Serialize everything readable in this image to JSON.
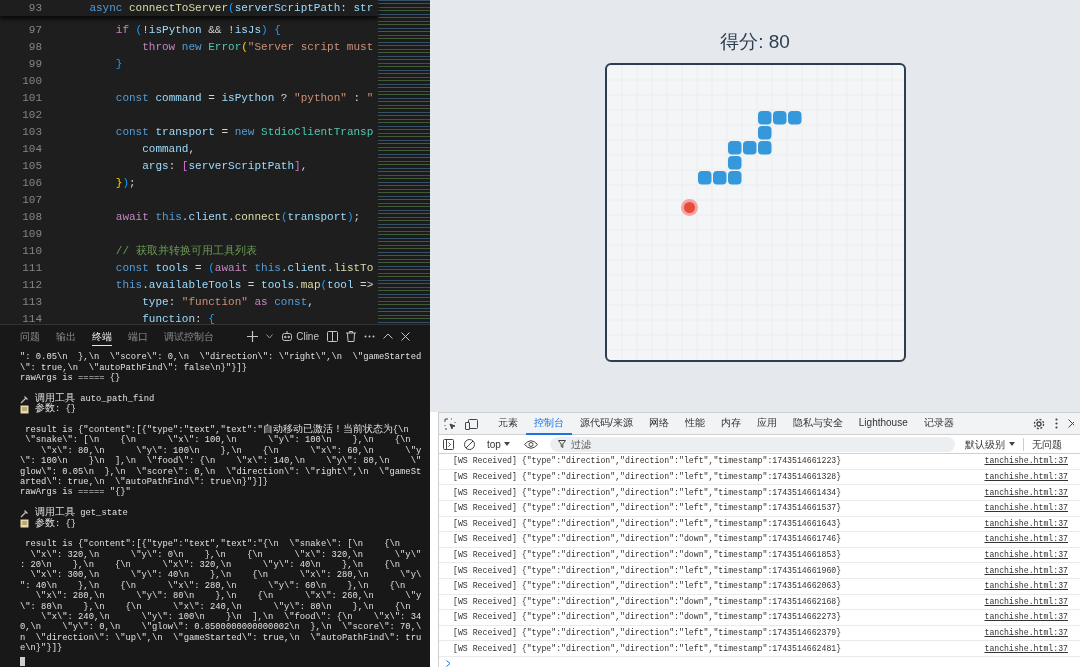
{
  "editor": {
    "sticky_line": {
      "number": "93",
      "tokens": [
        {
          "kind": "kw",
          "text": "    async"
        },
        {
          "kind": "fn",
          "text": " connectToServer"
        },
        {
          "kind": "br",
          "text": "("
        },
        {
          "kind": "var",
          "text": "serverScriptPath"
        },
        {
          "kind": "p",
          "text": ": "
        },
        {
          "kind": "var",
          "text": "str"
        }
      ]
    },
    "lines": [
      {
        "number": "97",
        "tokens": [
          {
            "kind": "ctl",
            "text": "        if"
          },
          {
            "kind": "br",
            "text": " ("
          },
          {
            "kind": "p",
            "text": "!"
          },
          {
            "kind": "var",
            "text": "isPython"
          },
          {
            "kind": "p",
            "text": " && !"
          },
          {
            "kind": "var",
            "text": "isJs"
          },
          {
            "kind": "br",
            "text": ") {"
          }
        ]
      },
      {
        "number": "98",
        "tokens": [
          {
            "kind": "ctl",
            "text": "            throw"
          },
          {
            "kind": "kw",
            "text": " new"
          },
          {
            "kind": "type",
            "text": " Error"
          },
          {
            "kind": "gold",
            "text": "("
          },
          {
            "kind": "str",
            "text": "\"Server script must"
          }
        ]
      },
      {
        "number": "99",
        "tokens": [
          {
            "kind": "br",
            "text": "        }"
          }
        ]
      },
      {
        "number": "100"
      },
      {
        "number": "101",
        "tokens": [
          {
            "kind": "kw",
            "text": "        const"
          },
          {
            "kind": "var",
            "text": " command"
          },
          {
            "kind": "p",
            "text": " = "
          },
          {
            "kind": "var",
            "text": "isPython"
          },
          {
            "kind": "p",
            "text": " ? "
          },
          {
            "kind": "str",
            "text": "\"python\""
          },
          {
            "kind": "p",
            "text": " : "
          },
          {
            "kind": "str",
            "text": "\""
          }
        ]
      },
      {
        "number": "102"
      },
      {
        "number": "103",
        "tokens": [
          {
            "kind": "kw",
            "text": "        const"
          },
          {
            "kind": "var",
            "text": " transport"
          },
          {
            "kind": "p",
            "text": " = "
          },
          {
            "kind": "kw",
            "text": "new"
          },
          {
            "kind": "type",
            "text": " StdioClientTransp"
          }
        ]
      },
      {
        "number": "104",
        "tokens": [
          {
            "kind": "var",
            "text": "            command"
          },
          {
            "kind": "p",
            "text": ","
          }
        ]
      },
      {
        "number": "105",
        "tokens": [
          {
            "kind": "var",
            "text": "            args"
          },
          {
            "kind": "p",
            "text": ": "
          },
          {
            "kind": "pink",
            "text": "["
          },
          {
            "kind": "var",
            "text": "serverScriptPath"
          },
          {
            "kind": "pink",
            "text": "]"
          },
          {
            "kind": "p",
            "text": ","
          }
        ]
      },
      {
        "number": "106",
        "tokens": [
          {
            "kind": "gold",
            "text": "        }"
          },
          {
            "kind": "br",
            "text": ")"
          },
          {
            "kind": "p",
            "text": ";"
          }
        ]
      },
      {
        "number": "107"
      },
      {
        "number": "108",
        "tokens": [
          {
            "kind": "ctl",
            "text": "        await"
          },
          {
            "kind": "kw",
            "text": " this"
          },
          {
            "kind": "p",
            "text": "."
          },
          {
            "kind": "var",
            "text": "client"
          },
          {
            "kind": "p",
            "text": "."
          },
          {
            "kind": "fn",
            "text": "connect"
          },
          {
            "kind": "br",
            "text": "("
          },
          {
            "kind": "var",
            "text": "transport"
          },
          {
            "kind": "br",
            "text": ")"
          },
          {
            "kind": "p",
            "text": ";"
          }
        ]
      },
      {
        "number": "109"
      },
      {
        "number": "110",
        "tokens": [
          {
            "kind": "com",
            "text": "        // 获取并转换可用工具列表"
          }
        ]
      },
      {
        "number": "111",
        "tokens": [
          {
            "kind": "kw",
            "text": "        const"
          },
          {
            "kind": "var",
            "text": " tools"
          },
          {
            "kind": "p",
            "text": " = "
          },
          {
            "kind": "br",
            "text": "("
          },
          {
            "kind": "ctl",
            "text": "await"
          },
          {
            "kind": "kw",
            "text": " this"
          },
          {
            "kind": "p",
            "text": "."
          },
          {
            "kind": "var",
            "text": "client"
          },
          {
            "kind": "p",
            "text": "."
          },
          {
            "kind": "fn",
            "text": "listTo"
          }
        ]
      },
      {
        "number": "112",
        "tokens": [
          {
            "kind": "kw",
            "text": "        this"
          },
          {
            "kind": "p",
            "text": "."
          },
          {
            "kind": "var",
            "text": "availableTools"
          },
          {
            "kind": "p",
            "text": " = "
          },
          {
            "kind": "var",
            "text": "tools"
          },
          {
            "kind": "p",
            "text": "."
          },
          {
            "kind": "fn",
            "text": "map"
          },
          {
            "kind": "br",
            "text": "("
          },
          {
            "kind": "var",
            "text": "tool"
          },
          {
            "kind": "p",
            "text": " =>"
          }
        ]
      },
      {
        "number": "113",
        "tokens": [
          {
            "kind": "var",
            "text": "            type"
          },
          {
            "kind": "p",
            "text": ": "
          },
          {
            "kind": "str",
            "text": "\"function\""
          },
          {
            "kind": "ctl",
            "text": " as"
          },
          {
            "kind": "kw",
            "text": " const"
          },
          {
            "kind": "p",
            "text": ","
          }
        ]
      },
      {
        "number": "114",
        "tokens": [
          {
            "kind": "var",
            "text": "            function"
          },
          {
            "kind": "p",
            "text": ": "
          },
          {
            "kind": "br",
            "text": "{"
          }
        ]
      }
    ]
  },
  "terminal": {
    "tabs": [
      {
        "label": "问题",
        "selected": false
      },
      {
        "label": "输出",
        "selected": false
      },
      {
        "label": "终端",
        "selected": true
      },
      {
        "label": "端口",
        "selected": false
      },
      {
        "label": "调试控制台",
        "selected": false
      }
    ],
    "cline_label": "Cline",
    "lines": [
      {
        "kind": "output",
        "text": "\": 0.05\\n  },\\n  \\\"score\\\": 0,\\n  \\\"direction\\\": \\\"right\\\",\\n  \\\"gameStarted"
      },
      {
        "kind": "output",
        "text": "\\\": true,\\n  \\\"autoPathFind\\\": false\\n}\"}]}"
      },
      {
        "kind": "output",
        "text": "rawArgs is ===== {}"
      },
      {
        "kind": "blank"
      },
      {
        "kind": "tool",
        "text": "调用工具 auto_path_find"
      },
      {
        "kind": "args",
        "text": "参数: {}"
      },
      {
        "kind": "blank"
      },
      {
        "kind": "output",
        "text": " result is {\"content\":[{\"type\":\"text\",\"text\":\"自动移动已激活！当前状态为{\\n"
      },
      {
        "kind": "output",
        "text": " \\\"snake\\\": [\\n    {\\n      \\\"x\\\": 100,\\n      \\\"y\\\": 100\\n    },\\n    {\\n"
      },
      {
        "kind": "output",
        "text": "    \\\"x\\\": 80,\\n      \\\"y\\\": 100\\n    },\\n    {\\n      \\\"x\\\": 60,\\n      \\\"y"
      },
      {
        "kind": "output",
        "text": "\\\": 100\\n    }\\n  ],\\n  \\\"food\\\": {\\n    \\\"x\\\": 140,\\n    \\\"y\\\": 80,\\n    \\\""
      },
      {
        "kind": "output",
        "text": "glow\\\": 0.05\\n  },\\n  \\\"score\\\": 0,\\n  \\\"direction\\\": \\\"right\\\",\\n  \\\"gameSt"
      },
      {
        "kind": "output",
        "text": "arted\\\": true,\\n  \\\"autoPathFind\\\": true\\n}\"}]}"
      },
      {
        "kind": "output",
        "text": "rawArgs is ===== \"{}\""
      },
      {
        "kind": "blank"
      },
      {
        "kind": "tool",
        "text": "调用工具 get_state"
      },
      {
        "kind": "args",
        "text": "参数: {}"
      },
      {
        "kind": "blank"
      },
      {
        "kind": "output",
        "text": " result is {\"content\":[{\"type\":\"text\",\"text\":\"{\\n  \\\"snake\\\": [\\n    {\\n"
      },
      {
        "kind": "output",
        "text": "  \\\"x\\\": 320,\\n      \\\"y\\\": 0\\n    },\\n    {\\n      \\\"x\\\": 320,\\n      \\\"y\\\""
      },
      {
        "kind": "output",
        "text": ": 20\\n    },\\n    {\\n      \\\"x\\\": 320,\\n      \\\"y\\\": 40\\n    },\\n    {\\n"
      },
      {
        "kind": "output",
        "text": "  \\\"x\\\": 300,\\n      \\\"y\\\": 40\\n    },\\n    {\\n      \\\"x\\\": 280,\\n      \\\"y\\"
      },
      {
        "kind": "output",
        "text": "\": 40\\n    },\\n    {\\n      \\\"x\\\": 280,\\n      \\\"y\\\": 60\\n    },\\n    {\\n"
      },
      {
        "kind": "output",
        "text": "   \\\"x\\\": 280,\\n      \\\"y\\\": 80\\n    },\\n    {\\n      \\\"x\\\": 260,\\n      \\\"y"
      },
      {
        "kind": "output",
        "text": "\\\": 80\\n    },\\n    {\\n      \\\"x\\\": 240,\\n      \\\"y\\\": 80\\n    },\\n    {\\n"
      },
      {
        "kind": "output",
        "text": "    \\\"x\\\": 240,\\n      \\\"y\\\": 100\\n    }\\n  ],\\n  \\\"food\\\": {\\n    \\\"x\\\": 34"
      },
      {
        "kind": "output",
        "text": "0,\\n    \\\"y\\\": 0,\\n    \\\"glow\\\": 0.8500000000000002\\n  },\\n  \\\"score\\\": 70,\\"
      },
      {
        "kind": "output",
        "text": "n  \\\"direction\\\": \\\"up\\\",\\n  \\\"gameStarted\\\": true,\\n  \\\"autoPathFind\\\": tru"
      },
      {
        "kind": "output",
        "text": "e\\n}\"}]}"
      },
      {
        "kind": "cursor"
      }
    ]
  },
  "game": {
    "score_label": "得分: 80"
  },
  "devtools": {
    "tabs": [
      {
        "label": "元素",
        "selected": false
      },
      {
        "label": "控制台",
        "selected": true
      },
      {
        "label": "源代码/来源",
        "selected": false
      },
      {
        "label": "网络",
        "selected": false
      },
      {
        "label": "性能",
        "selected": false
      },
      {
        "label": "内存",
        "selected": false
      },
      {
        "label": "应用",
        "selected": false
      },
      {
        "label": "隐私与安全",
        "selected": false
      },
      {
        "label": "Lighthouse",
        "selected": false
      },
      {
        "label": "记录器",
        "selected": false
      }
    ],
    "context": "top",
    "filter_placeholder": "过滤",
    "level_menu": "默认级别",
    "issues": "无问题",
    "messages": [
      {
        "text": "[WS Received] {\"type\":\"direction\",\"direction\":\"left\",\"timestamp\":1743514661223}",
        "source": "tanchishe.html:37"
      },
      {
        "text": "[WS Received] {\"type\":\"direction\",\"direction\":\"left\",\"timestamp\":1743514661328}",
        "source": "tanchishe.html:37"
      },
      {
        "text": "[WS Received] {\"type\":\"direction\",\"direction\":\"left\",\"timestamp\":1743514661434}",
        "source": "tanchishe.html:37"
      },
      {
        "text": "[WS Received] {\"type\":\"direction\",\"direction\":\"left\",\"timestamp\":1743514661537}",
        "source": "tanchishe.html:37"
      },
      {
        "text": "[WS Received] {\"type\":\"direction\",\"direction\":\"left\",\"timestamp\":1743514661643}",
        "source": "tanchishe.html:37"
      },
      {
        "text": "[WS Received] {\"type\":\"direction\",\"direction\":\"down\",\"timestamp\":1743514661746}",
        "source": "tanchishe.html:37"
      },
      {
        "text": "[WS Received] {\"type\":\"direction\",\"direction\":\"down\",\"timestamp\":1743514661853}",
        "source": "tanchishe.html:37"
      },
      {
        "text": "[WS Received] {\"type\":\"direction\",\"direction\":\"left\",\"timestamp\":1743514661960}",
        "source": "tanchishe.html:37"
      },
      {
        "text": "[WS Received] {\"type\":\"direction\",\"direction\":\"left\",\"timestamp\":1743514662063}",
        "source": "tanchishe.html:37"
      },
      {
        "text": "[WS Received] {\"type\":\"direction\",\"direction\":\"down\",\"timestamp\":1743514662168}",
        "source": "tanchishe.html:37"
      },
      {
        "text": "[WS Received] {\"type\":\"direction\",\"direction\":\"down\",\"timestamp\":1743514662273}",
        "source": "tanchishe.html:37"
      },
      {
        "text": "[WS Received] {\"type\":\"direction\",\"direction\":\"left\",\"timestamp\":1743514662379}",
        "source": "tanchishe.html:37"
      },
      {
        "text": "[WS Received] {\"type\":\"direction\",\"direction\":\"left\",\"timestamp\":1743514662481}",
        "source": "tanchishe.html:37"
      }
    ]
  }
}
